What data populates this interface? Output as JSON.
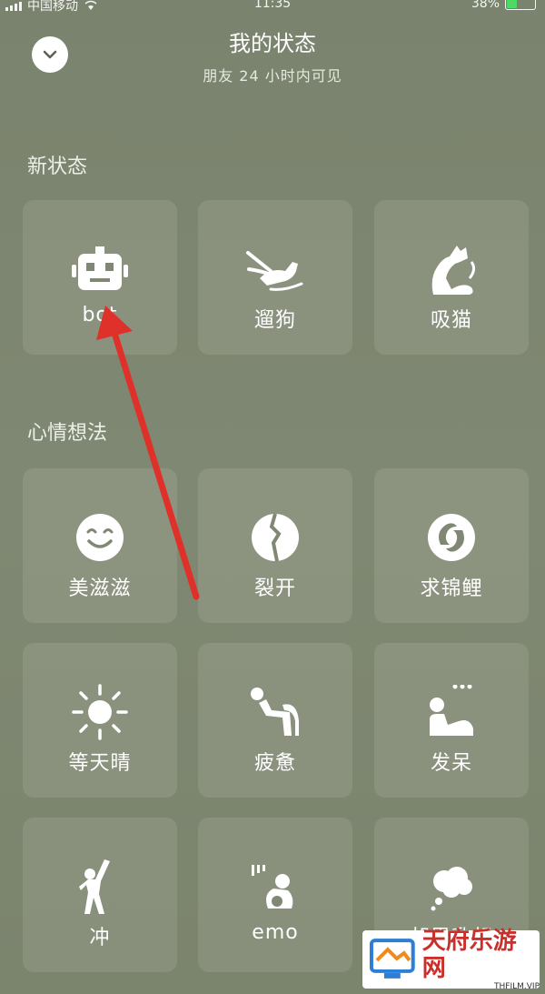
{
  "status_bar": {
    "carrier": "中国移动",
    "time": "11:35",
    "battery": "38%",
    "battery_level": 0.38
  },
  "header": {
    "title": "我的状态",
    "subtitle": "朋友 24 小时内可见"
  },
  "sections": {
    "new": {
      "label": "新状态",
      "tiles": [
        "bot",
        "遛狗",
        "吸猫"
      ]
    },
    "mood": {
      "label": "心情想法",
      "tiles": [
        "美滋滋",
        "裂开",
        "求锦鲤",
        "等天晴",
        "疲惫",
        "发呆",
        "冲",
        "emo",
        "胡思乱想"
      ]
    }
  },
  "icons": [
    "chevron-down-icon",
    "robot-icon",
    "dog-walk-icon",
    "cat-icon",
    "smile-icon",
    "crack-icon",
    "koi-icon",
    "sun-icon",
    "tired-icon",
    "daze-icon",
    "rush-icon",
    "emo-icon",
    "thought-cloud-icon"
  ],
  "annotation_color": "#e0302a",
  "watermark": {
    "main": "天府乐游网",
    "sub": "THFILM.VIP"
  }
}
